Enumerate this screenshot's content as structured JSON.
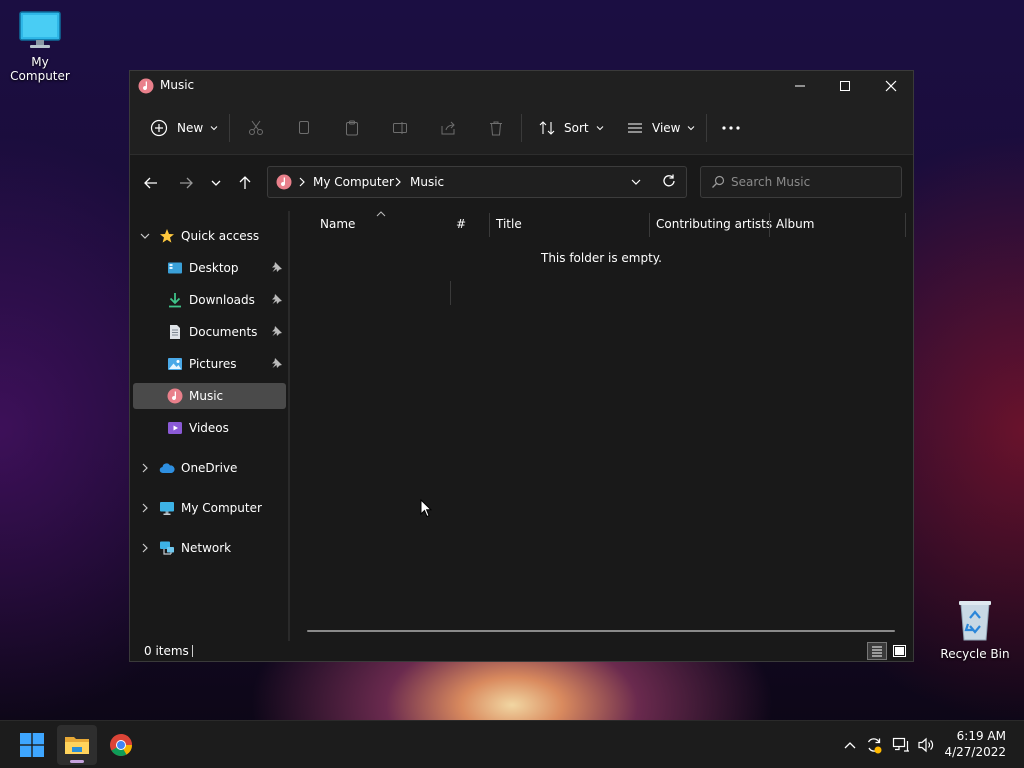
{
  "desktop": {
    "my_computer_label": "My Computer",
    "recycle_bin_label": "Recycle Bin"
  },
  "window": {
    "title": "Music"
  },
  "toolbar": {
    "new_label": "New",
    "sort_label": "Sort",
    "view_label": "View"
  },
  "address": {
    "crumbs": [
      "My Computer",
      "Music"
    ]
  },
  "search": {
    "placeholder": "Search Music"
  },
  "sidebar": {
    "quick_access": "Quick access",
    "items": [
      {
        "label": "Desktop",
        "icon": "desktop-icon",
        "pinned": true
      },
      {
        "label": "Downloads",
        "icon": "download-icon",
        "pinned": true
      },
      {
        "label": "Documents",
        "icon": "document-icon",
        "pinned": true
      },
      {
        "label": "Pictures",
        "icon": "pictures-icon",
        "pinned": true
      },
      {
        "label": "Music",
        "icon": "music-icon",
        "selected": true
      },
      {
        "label": "Videos",
        "icon": "videos-icon"
      }
    ],
    "onedrive": "OneDrive",
    "my_computer": "My Computer",
    "network": "Network"
  },
  "columns": [
    "Name",
    "#",
    "Title",
    "Contributing artists",
    "Album"
  ],
  "empty_message": "This folder is empty.",
  "status": {
    "item_count": "0 items"
  },
  "clock": {
    "time": "6:19 AM",
    "date": "4/27/2022"
  },
  "colors": {
    "accent": "#ffc83d",
    "selected": "#4a4a4a"
  }
}
